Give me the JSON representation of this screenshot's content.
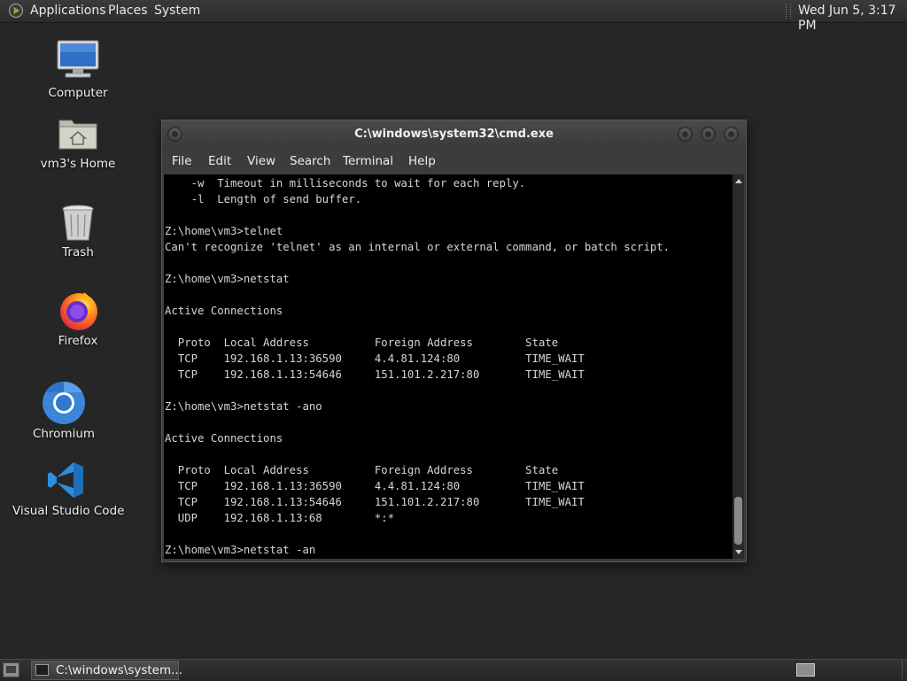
{
  "top_panel": {
    "menus": [
      "Applications",
      "Places",
      "System"
    ],
    "clock": "Wed Jun  5, 3:17 PM"
  },
  "desktop": {
    "icons": [
      {
        "label": "Computer",
        "icon": "computer-icon"
      },
      {
        "label": "vm3's Home",
        "icon": "home-folder-icon"
      },
      {
        "label": "Trash",
        "icon": "trash-icon"
      },
      {
        "label": "Firefox",
        "icon": "firefox-icon"
      },
      {
        "label": "Chromium",
        "icon": "chromium-icon"
      },
      {
        "label": "Visual Studio Code",
        "icon": "vscode-icon"
      }
    ]
  },
  "window": {
    "title": "C:\\windows\\system32\\cmd.exe",
    "menus": [
      "File",
      "Edit",
      "View",
      "Search",
      "Terminal",
      "Help"
    ]
  },
  "terminal": {
    "lines": [
      "    -w  Timeout in milliseconds to wait for each reply.",
      "    -l  Length of send buffer.",
      "",
      "Z:\\home\\vm3>telnet",
      "Can't recognize 'telnet' as an internal or external command, or batch script.",
      "",
      "Z:\\home\\vm3>netstat",
      "",
      "Active Connections",
      "",
      "  Proto  Local Address          Foreign Address        State",
      "  TCP    192.168.1.13:36590     4.4.81.124:80          TIME_WAIT",
      "  TCP    192.168.1.13:54646     151.101.2.217:80       TIME_WAIT",
      "",
      "Z:\\home\\vm3>netstat -ano",
      "",
      "Active Connections",
      "",
      "  Proto  Local Address          Foreign Address        State",
      "  TCP    192.168.1.13:36590     4.4.81.124:80          TIME_WAIT",
      "  TCP    192.168.1.13:54646     151.101.2.217:80       TIME_WAIT",
      "  UDP    192.168.1.13:68        *:*",
      "",
      "Z:\\home\\vm3>netstat -an"
    ]
  },
  "taskbar": {
    "window_button_label": "C:\\windows\\system..."
  },
  "colors": {
    "desktop_background": "#262626",
    "terminal_background": "#000000",
    "terminal_text": "#d6d6d6",
    "vscode_blue": "#2d8fe0",
    "chromium_blue": "#3b86d9"
  }
}
